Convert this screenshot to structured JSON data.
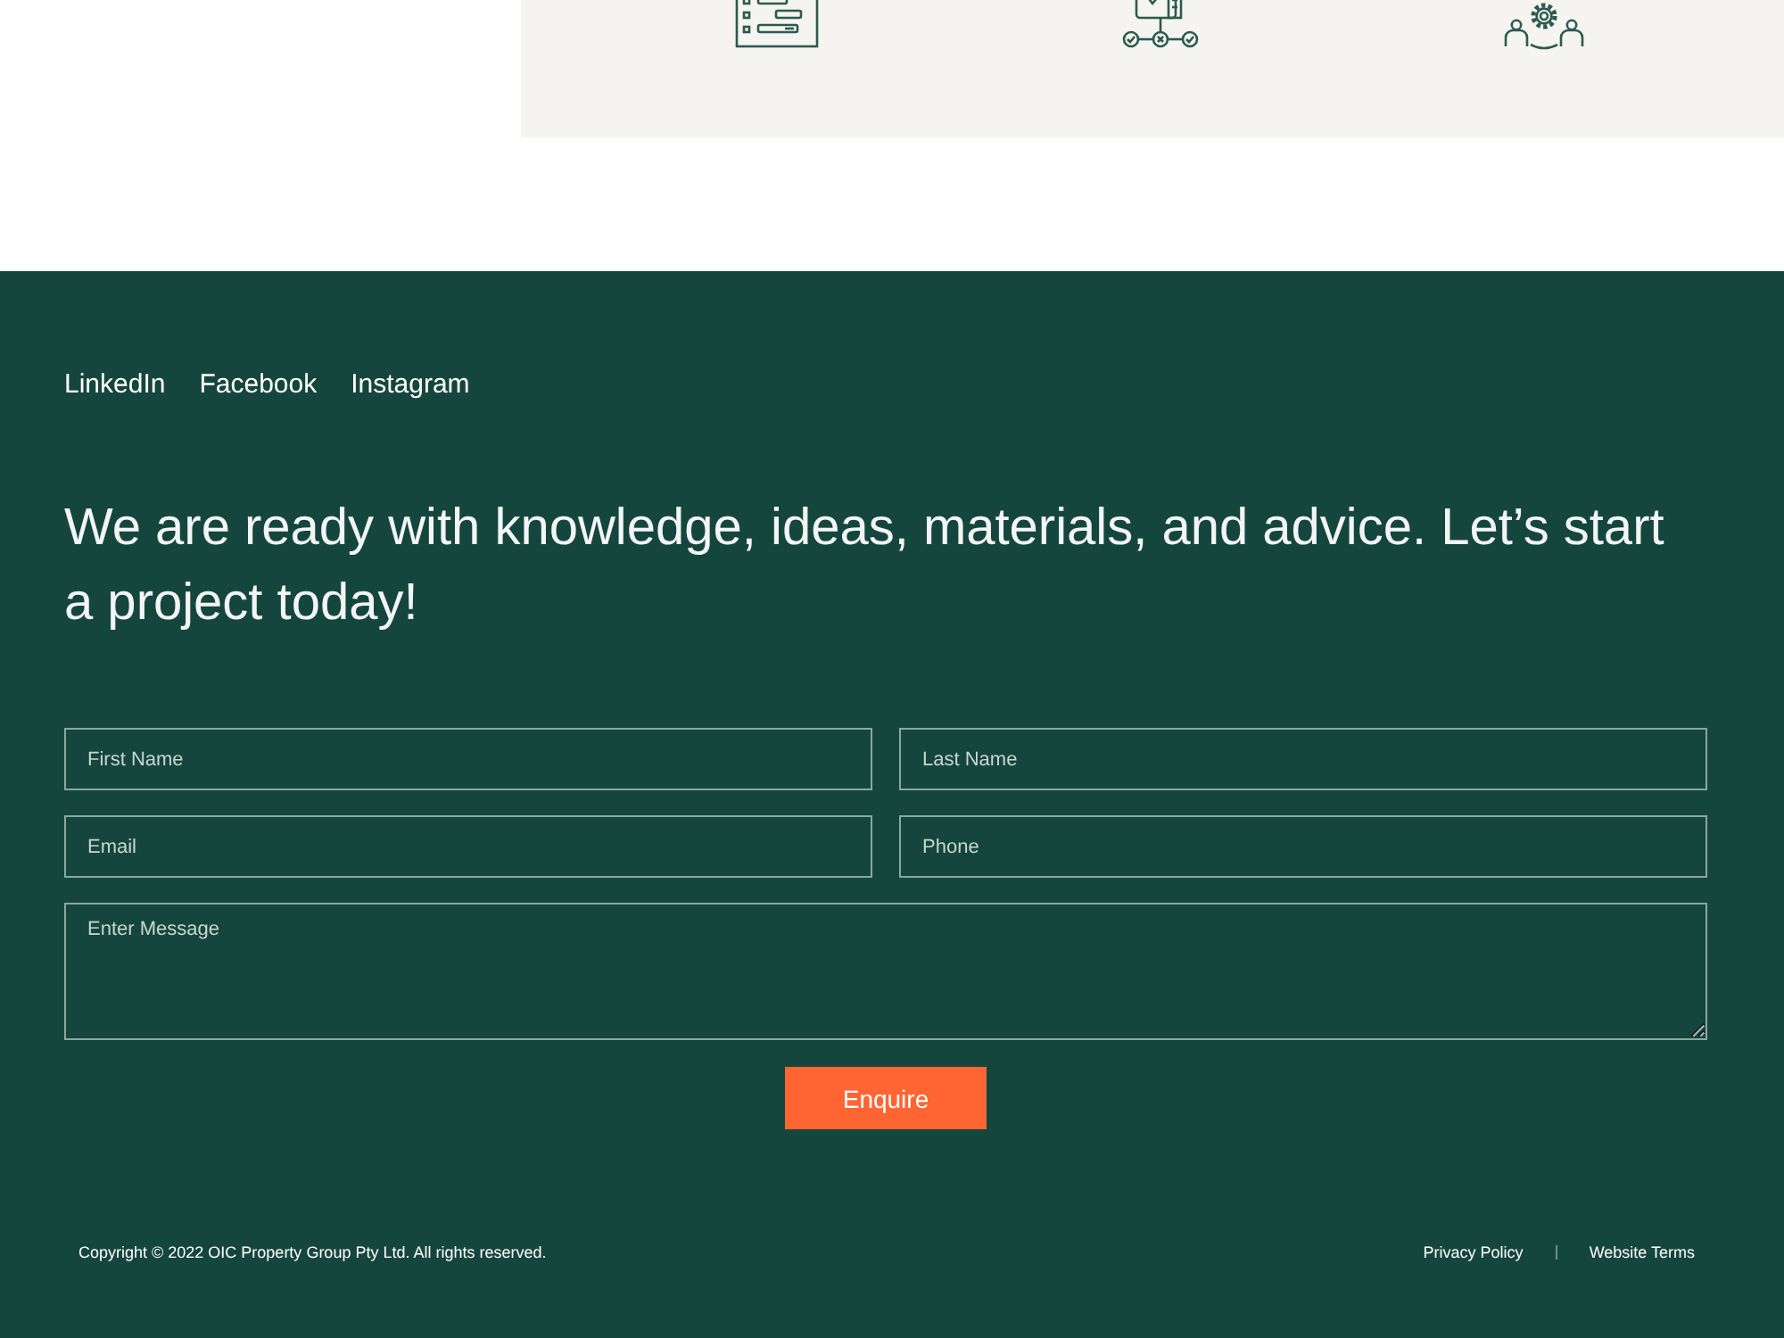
{
  "services": {
    "icons": [
      {
        "kind": "timeline"
      },
      {
        "kind": "workflow"
      },
      {
        "kind": "team"
      }
    ]
  },
  "footer": {
    "social_links": [
      "LinkedIn",
      "Facebook",
      "Instagram"
    ],
    "heading": "We are ready with knowledge, ideas, materials, and advice. Let’s start a project today!",
    "form": {
      "fields": [
        {
          "kind": "input",
          "placeholder": "First Name"
        },
        {
          "kind": "input",
          "placeholder": "Last Name"
        },
        {
          "kind": "input",
          "placeholder": "Email"
        },
        {
          "kind": "input",
          "placeholder": "Phone"
        },
        {
          "kind": "textarea",
          "placeholder": "Enter Message"
        }
      ],
      "submit": "Enquire"
    },
    "copyright": "Copyright © 2022 OIC Property Group Pty Ltd. All rights reserved.",
    "legal_links": [
      "Privacy Policy",
      "Website Terms"
    ]
  }
}
